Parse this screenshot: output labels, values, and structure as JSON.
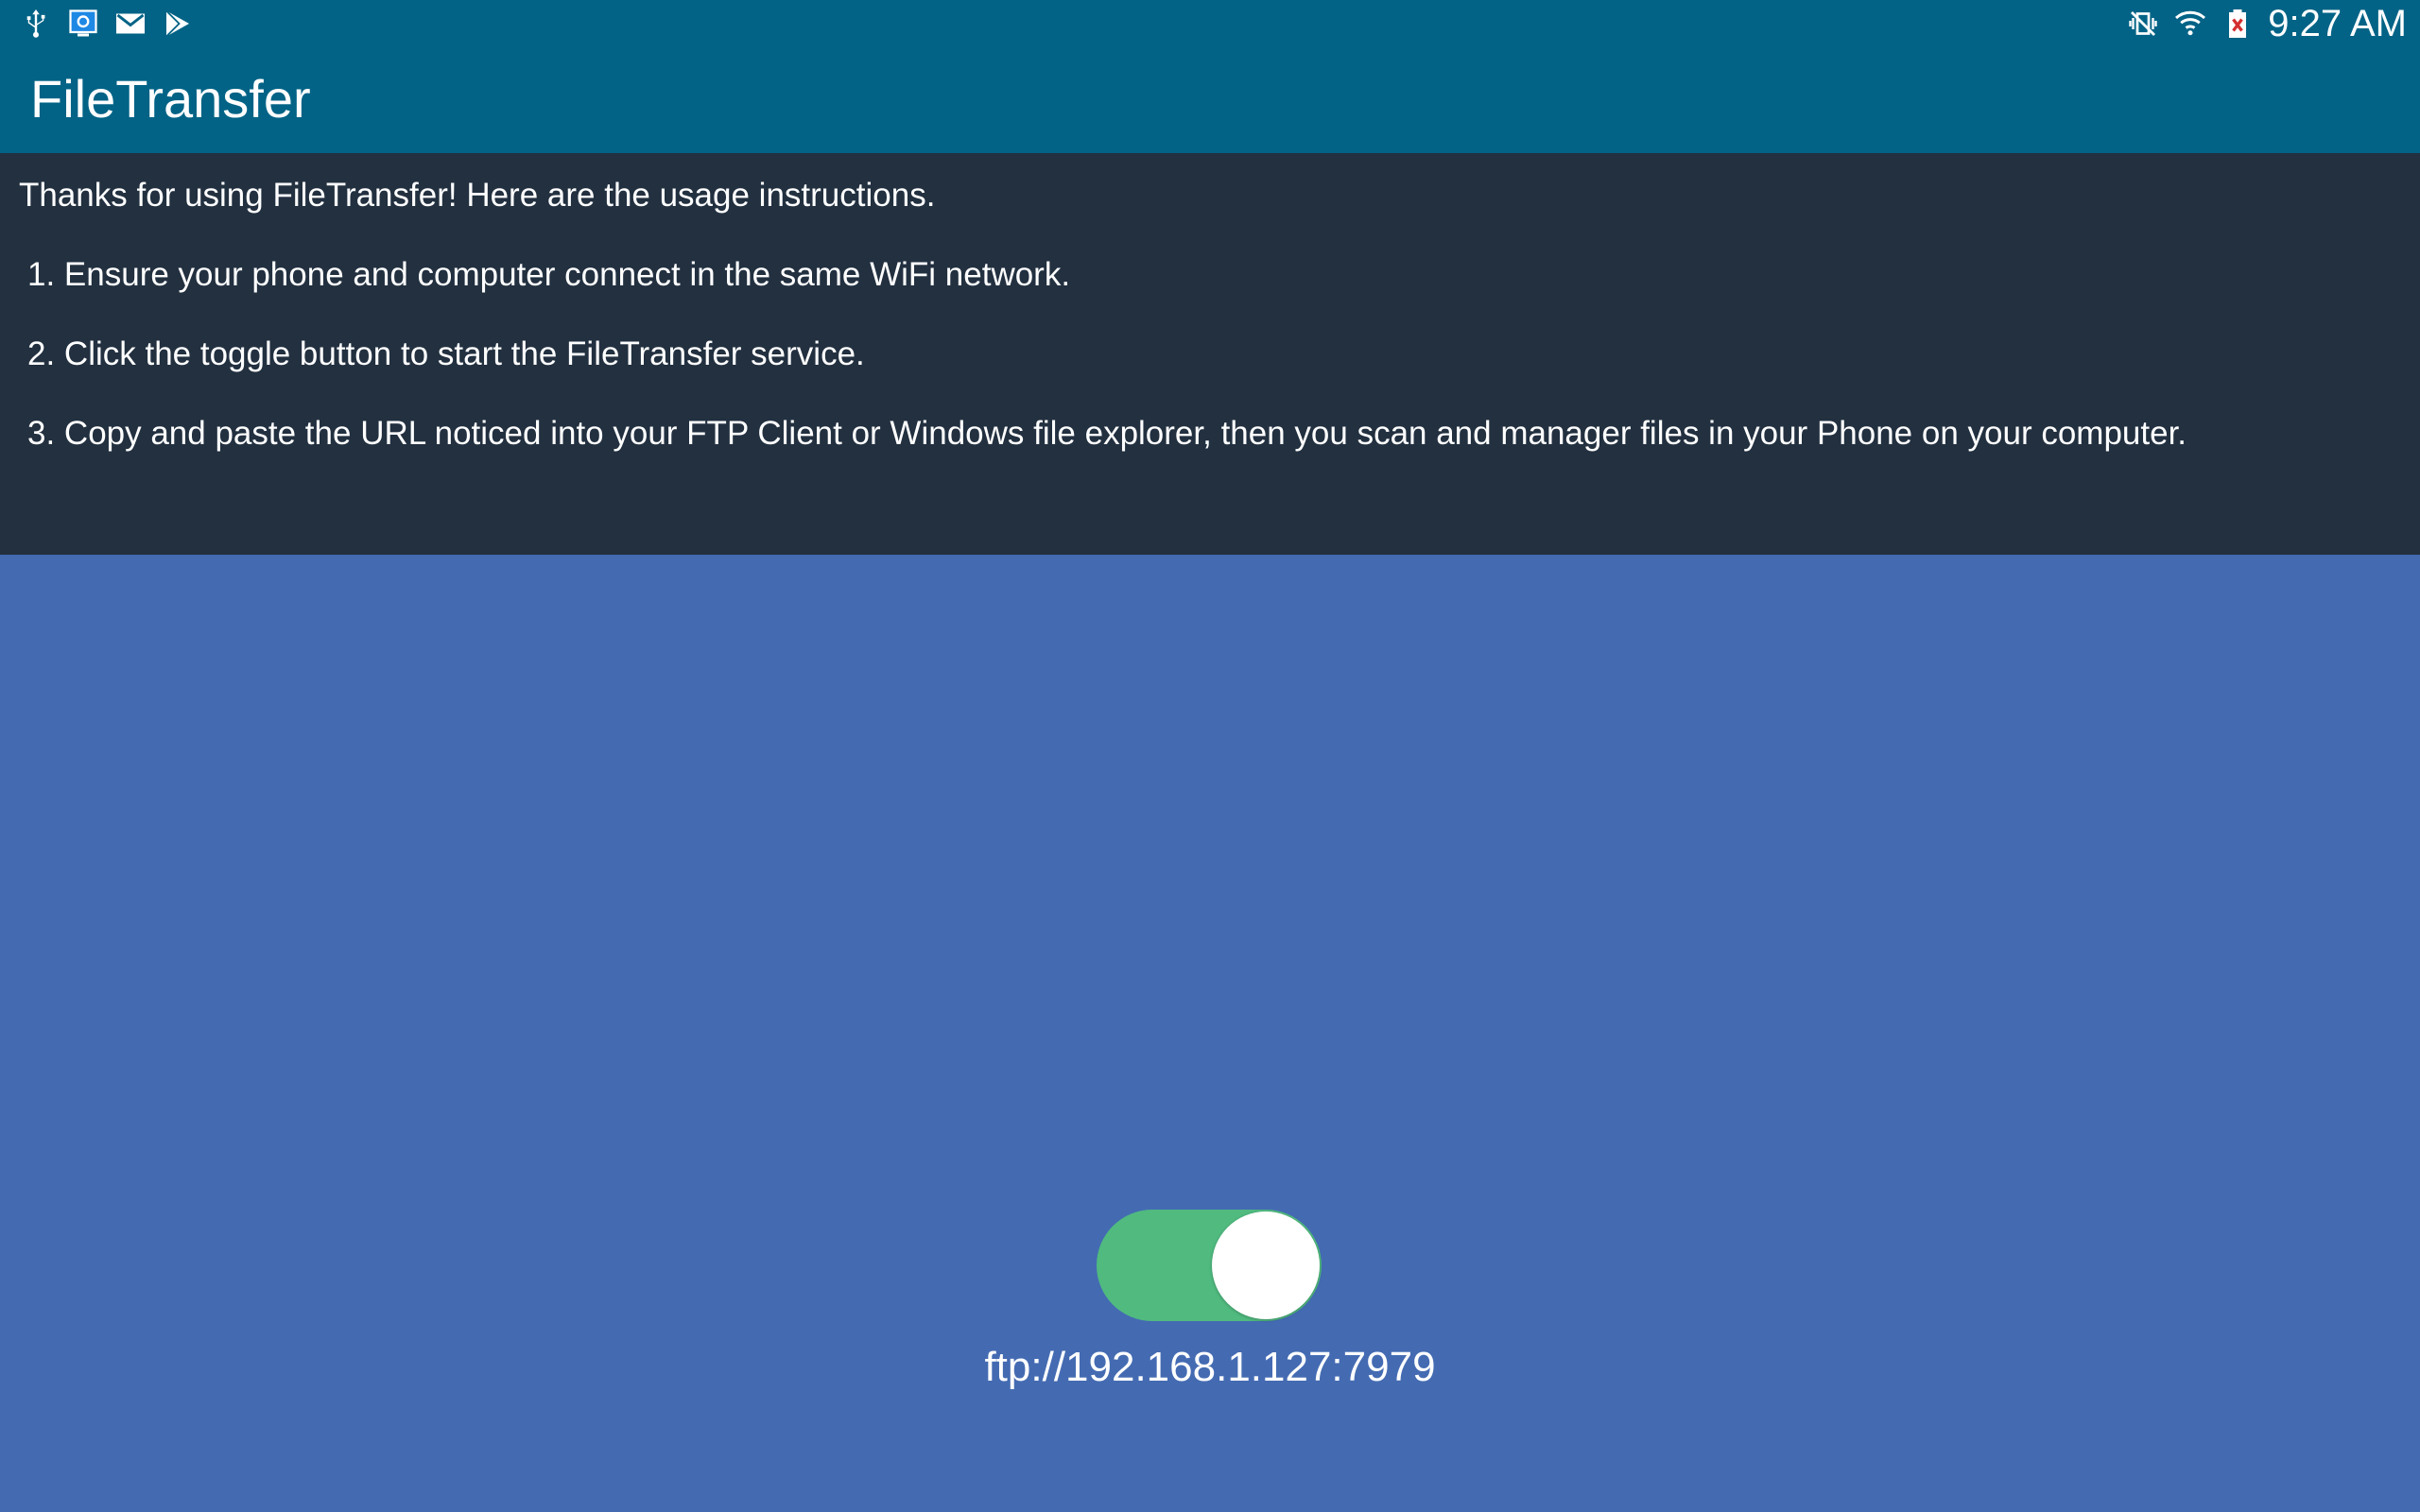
{
  "status_bar": {
    "time": "9:27 AM",
    "left_icons": [
      "usb-icon",
      "screen-mirror-icon",
      "gmail-icon",
      "play-store-icon"
    ],
    "right_icons": [
      "vibrate-mute-icon",
      "wifi-icon",
      "battery-charging-icon"
    ]
  },
  "app": {
    "title": "FileTransfer"
  },
  "instructions": {
    "intro": "Thanks for using FileTransfer! Here are the usage instructions.",
    "steps": [
      "1. Ensure your phone and computer connect in the same WiFi network.",
      "2. Click the toggle button to start the FileTransfer service.",
      "3. Copy and paste the URL noticed into your FTP Client or Windows file explorer, then you scan and manager files in your Phone on your computer."
    ]
  },
  "service": {
    "toggle_on": true,
    "url": "ftp://192.168.1.127:7979"
  },
  "colors": {
    "status_bar": "#026386",
    "action_bar": "#026386",
    "instructions_bg": "#223040",
    "main_bg": "#446bb2",
    "toggle_on": "#50ba7f"
  }
}
